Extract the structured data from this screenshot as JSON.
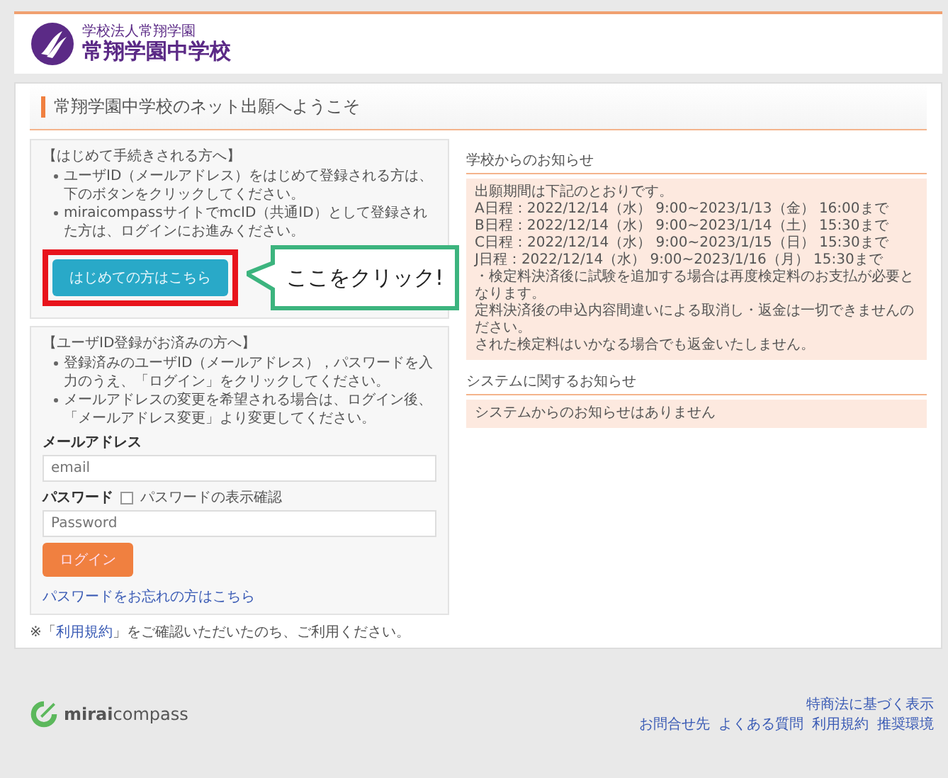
{
  "header": {
    "school_kana": "学校法人常翔学園",
    "school_name": "常翔学園中学校"
  },
  "page_title": "常翔学園中学校のネット出願へようこそ",
  "first_time": {
    "heading": "【はじめて手続きされる方へ】",
    "bullets": [
      "ユーザID（メールアドレス）をはじめて登録される方は、下のボタンをクリックしてください。",
      "miraicompassサイトでmcID（共通ID）として登録された方は、ログインにお進みください。"
    ],
    "button": "はじめての方はこちら"
  },
  "callout": {
    "text": "ここをクリック!"
  },
  "login": {
    "heading": "【ユーザID登録がお済みの方へ】",
    "bullets": [
      "登録済みのユーザID（メールアドレス），パスワードを入力のうえ、「ログイン」をクリックしてください。",
      "メールアドレスの変更を希望される場合は、ログイン後、「メールアドレス変更」より変更してください。"
    ],
    "email_label": "メールアドレス",
    "email": {
      "placeholder": "email"
    },
    "password_label": "パスワード",
    "show_password": {
      "label": "パスワードの表示確認",
      "checked": false
    },
    "password": {
      "placeholder": "Password"
    },
    "button": "ログイン",
    "forgot_link": "パスワードをお忘れの方はこちら"
  },
  "terms_note": "※「**利用規約**」をご確認いただいたのち、ご利用ください。",
  "school_notices": {
    "title": "学校からのお知らせ",
    "lines": [
      "出願期間は下記のとおりです。",
      "A日程：2022/12/14（水） 9:00~2023/1/13（金） 16:00まで",
      "B日程：2022/12/14（水） 9:00~2023/1/14（土） 15:30まで",
      "C日程：2022/12/14（水） 9:00~2023/1/15（日） 15:30まで",
      "J日程：2022/12/14（水） 9:00~2023/1/16（月） 15:30まで",
      "・検定料決済後に試験を追加する場合は再度検定料のお支払が必要となります。",
      "定料決済後の申込内容間違いによる取消し・返金は一切できませんの",
      "ださい。",
      "された検定料はいかなる場合でも返金いたしません。"
    ]
  },
  "system_notices": {
    "title": "システムに関するお知らせ",
    "lines": [
      "システムからのお知らせはありません"
    ]
  },
  "footer": {
    "brand_bold": "mirai",
    "brand": "compass",
    "links_top": [
      "特商法に基づく表示"
    ],
    "links": [
      "お問合せ先",
      "よくある質問",
      "利用規約",
      "推奨環境"
    ]
  }
}
